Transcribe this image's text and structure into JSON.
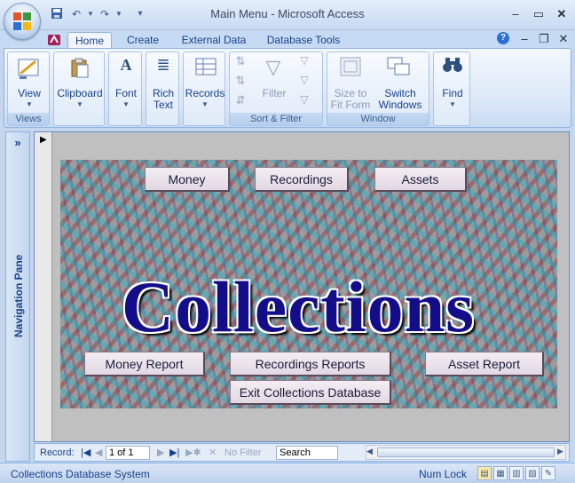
{
  "window": {
    "title": "Main Menu - Microsoft Access"
  },
  "quick_access": {
    "save_icon": "save-icon",
    "undo_icon": "undo-icon",
    "redo_icon": "redo-icon",
    "customize_icon": "customize-icon"
  },
  "tabs": [
    {
      "label": "Home",
      "active": true
    },
    {
      "label": "Create"
    },
    {
      "label": "External Data"
    },
    {
      "label": "Database Tools"
    }
  ],
  "ribbon": {
    "views": {
      "view_label": "View",
      "group_label": "Views"
    },
    "clipboard": {
      "label": "Clipboard"
    },
    "font": {
      "label": "Font"
    },
    "rich_text": {
      "line1": "Rich",
      "line2": "Text"
    },
    "records": {
      "label": "Records"
    },
    "sort_filter": {
      "filter_label": "Filter",
      "group_label": "Sort & Filter"
    },
    "window": {
      "size_line1": "Size to",
      "size_line2": "Fit Form",
      "switch_line1": "Switch",
      "switch_line2": "Windows",
      "group_label": "Window"
    },
    "find": {
      "label": "Find"
    }
  },
  "nav_pane": {
    "label": "Navigation Pane",
    "toggle": "»"
  },
  "form": {
    "buttons": {
      "money": "Money",
      "recordings": "Recordings",
      "assets": "Assets",
      "money_report": "Money Report",
      "recordings_reports": "Recordings Reports",
      "asset_report": "Asset Report",
      "exit": "Exit Collections Database"
    },
    "title": "Collections"
  },
  "record_nav": {
    "label": "Record:",
    "position": "1 of 1",
    "no_filter": "No Filter",
    "search": "Search"
  },
  "status_bar": {
    "left": "Collections Database System",
    "num_lock": "Num Lock"
  },
  "colors": {
    "accent": "#15428b",
    "title_text": "#140d8a"
  }
}
